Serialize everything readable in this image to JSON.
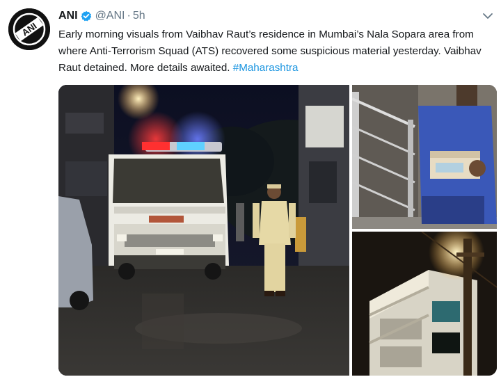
{
  "tweet": {
    "author_name": "ANI",
    "author_handle": "@ANI",
    "separator": "·",
    "time": "5h",
    "text_main": "Early morning visuals from Vaibhav Raut’s residence in Mumbai’s Nala Sopara area from where Anti-Terrorism Squad (ATS) recovered some suspicious material yesterday. Vaibhav Raut detained. More details awaited. ",
    "hashtag": "#Maharashtra",
    "verified": true,
    "avatar_logo_text": "ANI"
  },
  "icons": {
    "avatar": "ani-logo-icon",
    "verified": "verified-badge-icon",
    "menu": "chevron-down-icon"
  },
  "colors": {
    "link": "#1b95e0",
    "verified": "#1da1f2",
    "secondary_text": "#657786",
    "primary_text": "#14171a"
  },
  "media": {
    "photos": [
      {
        "id": "photo-street-van-police"
      },
      {
        "id": "photo-man-carrying-box"
      },
      {
        "id": "photo-building-night"
      }
    ]
  }
}
